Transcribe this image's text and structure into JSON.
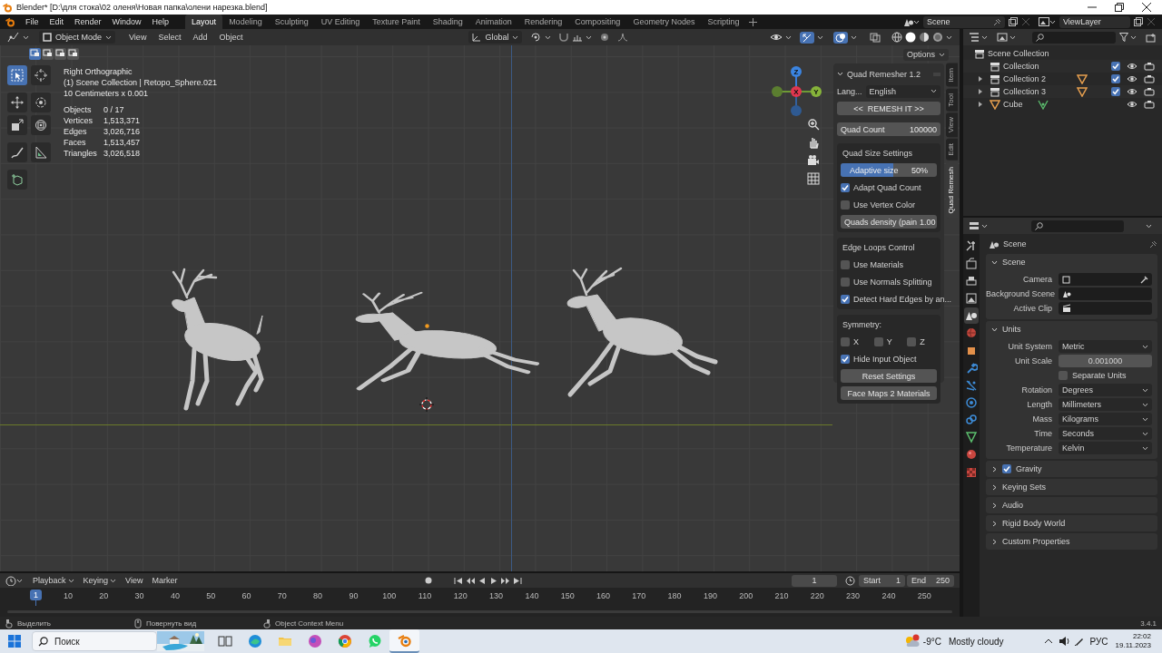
{
  "window": {
    "title": "Blender* [D:\\для стока\\02 оленя\\Новая папка\\олени нарезка.blend]"
  },
  "topbar": {
    "menus": [
      "File",
      "Edit",
      "Render",
      "Window",
      "Help"
    ],
    "workspaces": [
      {
        "label": "Layout",
        "selected": true
      },
      {
        "label": "Modeling",
        "selected": false
      },
      {
        "label": "Sculpting",
        "selected": false
      },
      {
        "label": "UV Editing",
        "selected": false
      },
      {
        "label": "Texture Paint",
        "selected": false
      },
      {
        "label": "Shading",
        "selected": false
      },
      {
        "label": "Animation",
        "selected": false
      },
      {
        "label": "Rendering",
        "selected": false
      },
      {
        "label": "Compositing",
        "selected": false
      },
      {
        "label": "Geometry Nodes",
        "selected": false
      },
      {
        "label": "Scripting",
        "selected": false
      }
    ],
    "scene": "Scene",
    "view_layer": "ViewLayer"
  },
  "viewport": {
    "mode": "Object Mode",
    "menus": [
      "View",
      "Select",
      "Add",
      "Object"
    ],
    "orientation": "Global",
    "options": "Options",
    "selection_modes": [
      {
        "selected": true
      },
      {
        "selected": false
      },
      {
        "selected": false
      },
      {
        "selected": false
      }
    ],
    "tools": [
      {
        "kind": "select",
        "selected": true
      },
      {
        "kind": "cursor",
        "selected": false
      },
      {
        "kind": "move",
        "selected": false
      },
      {
        "kind": "rotate",
        "selected": false
      },
      {
        "kind": "scale",
        "selected": false
      },
      {
        "kind": "transform",
        "selected": false
      },
      {
        "kind": "annotate",
        "selected": false
      },
      {
        "kind": "measure",
        "selected": false
      },
      {
        "kind": "add-cube",
        "selected": false
      }
    ],
    "overlay": {
      "lines": [
        "Right Orthographic",
        "(1) Scene Collection | Retopo_Sphere.021",
        "10 Centimeters x 0.001"
      ],
      "stats": [
        {
          "label": "Objects",
          "value": "0 / 17"
        },
        {
          "label": "Vertices",
          "value": "1,513,371"
        },
        {
          "label": "Edges",
          "value": "3,026,716"
        },
        {
          "label": "Faces",
          "value": "1,513,457"
        },
        {
          "label": "Triangles",
          "value": "3,026,518"
        }
      ]
    },
    "gizmo": {
      "labels": [
        "Z",
        "X",
        "Y"
      ]
    }
  },
  "sidebar": {
    "tabs": [
      {
        "label": "Item",
        "selected": false
      },
      {
        "label": "Tool",
        "selected": false
      },
      {
        "label": "View",
        "selected": false
      },
      {
        "label": "Edit",
        "selected": false
      },
      {
        "label": "Quad Remesh",
        "selected": true
      }
    ],
    "quad_remesher": {
      "title": "Quad Remesher 1.2",
      "language_label": "Lang...",
      "language": "English",
      "remesh_button": "<<  REMESH IT >>",
      "quad_count_label": "Quad Count",
      "quad_count": "100000",
      "sections": [
        {
          "title": "Quad Size Settings",
          "items": [
            {
              "kind": "slider",
              "label": "Adaptive size",
              "value": "50%",
              "level": 0.55
            },
            {
              "kind": "checkbox",
              "label": "Adapt Quad Count",
              "checked": true
            },
            {
              "kind": "checkbox",
              "label": "Use Vertex Color",
              "checked": false
            },
            {
              "kind": "field",
              "label": "Quads density (pain",
              "value": "1.00"
            }
          ]
        },
        {
          "title": "Edge Loops Control",
          "items": [
            {
              "kind": "checkbox",
              "label": "Use Materials",
              "checked": false
            },
            {
              "kind": "checkbox",
              "label": "Use Normals Splitting",
              "checked": false
            },
            {
              "kind": "checkbox",
              "label": "Detect Hard Edges by an...",
              "checked": true
            }
          ]
        },
        {
          "title": "Symmetry:",
          "items": [
            {
              "kind": "checkrow",
              "options": [
                {
                  "label": "X",
                  "checked": false
                },
                {
                  "label": "Y",
                  "checked": false
                },
                {
                  "label": "Z",
                  "checked": false
                }
              ]
            },
            {
              "kind": "checkbox",
              "label": "Hide Input Object",
              "checked": true
            },
            {
              "kind": "button",
              "label": "Reset Settings"
            },
            {
              "kind": "button",
              "label": "Face Maps 2 Materials"
            }
          ]
        }
      ]
    }
  },
  "timeline": {
    "menus": [
      "Playback",
      "Keying",
      "View",
      "Marker"
    ],
    "current_frame": "1",
    "start_label": "Start",
    "start": "1",
    "end_label": "End",
    "end": "250",
    "playhead": "1",
    "ticks": [
      "10",
      "20",
      "30",
      "40",
      "50",
      "60",
      "70",
      "80",
      "90",
      "100",
      "110",
      "120",
      "130",
      "140",
      "150",
      "160",
      "170",
      "180",
      "190",
      "200",
      "210",
      "220",
      "230",
      "240",
      "250"
    ]
  },
  "outliner": {
    "root": "Scene Collection",
    "items": [
      {
        "kind": "collection",
        "label": "Collection",
        "checked": true,
        "visible": true,
        "renderable": true
      },
      {
        "kind": "collection",
        "label": "Collection 2",
        "expanded": false,
        "checked": true,
        "visible": true,
        "renderable": true
      },
      {
        "kind": "collection",
        "label": "Collection 3",
        "expanded": false,
        "checked": true,
        "visible": true,
        "renderable": true
      },
      {
        "kind": "object",
        "label": "Cube",
        "expanded": false,
        "visible": true,
        "renderable": true
      }
    ]
  },
  "properties": {
    "tabs": [
      {
        "kind": "tool",
        "selected": false
      },
      {
        "kind": "render",
        "selected": false
      },
      {
        "kind": "output",
        "selected": false
      },
      {
        "kind": "view_layer",
        "selected": false
      },
      {
        "kind": "scene",
        "selected": true
      },
      {
        "kind": "world",
        "selected": false
      },
      {
        "kind": "object",
        "selected": false
      },
      {
        "kind": "modifier",
        "selected": false
      },
      {
        "kind": "particles",
        "selected": false
      },
      {
        "kind": "physics",
        "selected": false
      },
      {
        "kind": "constraints",
        "selected": false
      },
      {
        "kind": "data",
        "selected": false
      },
      {
        "kind": "material",
        "selected": false
      },
      {
        "kind": "texture",
        "selected": false
      }
    ],
    "context": "Scene",
    "panels": [
      {
        "title": "Scene",
        "expanded": true,
        "rows": [
          {
            "kind": "camera-field",
            "label": "Camera"
          },
          {
            "kind": "scene-field",
            "label": "Background Scene"
          },
          {
            "kind": "clip-field",
            "label": "Active Clip"
          }
        ]
      },
      {
        "title": "Units",
        "expanded": true,
        "rows": [
          {
            "kind": "dropdown",
            "label": "Unit System",
            "value": "Metric"
          },
          {
            "kind": "number",
            "label": "Unit Scale",
            "value": "0.001000"
          },
          {
            "kind": "checkbox",
            "label": "Separate Units",
            "checked": false
          },
          {
            "kind": "dropdown",
            "label": "Rotation",
            "value": "Degrees"
          },
          {
            "kind": "dropdown",
            "label": "Length",
            "value": "Millimeters"
          },
          {
            "kind": "dropdown",
            "label": "Mass",
            "value": "Kilograms"
          },
          {
            "kind": "dropdown",
            "label": "Time",
            "value": "Seconds"
          },
          {
            "kind": "dropdown",
            "label": "Temperature",
            "value": "Kelvin"
          }
        ]
      },
      {
        "title": "Gravity",
        "expanded": false,
        "checked": true
      },
      {
        "title": "Keying Sets",
        "expanded": false
      },
      {
        "title": "Audio",
        "expanded": false
      },
      {
        "title": "Rigid Body World",
        "expanded": false
      },
      {
        "title": "Custom Properties",
        "expanded": false
      }
    ]
  },
  "status_bar": {
    "items": [
      "Выделить",
      "Повернуть вид",
      "Object Context Menu"
    ],
    "version": "3.4.1"
  },
  "taskbar": {
    "search_placeholder": "Поиск",
    "apps": [
      {
        "kind": "task-view",
        "selected": false
      },
      {
        "kind": "web",
        "selected": false
      },
      {
        "kind": "folder",
        "selected": false
      },
      {
        "kind": "app",
        "selected": false
      },
      {
        "kind": "browser",
        "selected": false
      },
      {
        "kind": "chat",
        "selected": false
      },
      {
        "kind": "blender",
        "selected": true
      }
    ],
    "temperature": "-9°C",
    "weather": "Mostly cloudy",
    "language": "РУС",
    "time": "22:02",
    "date": "19.11.2023"
  }
}
